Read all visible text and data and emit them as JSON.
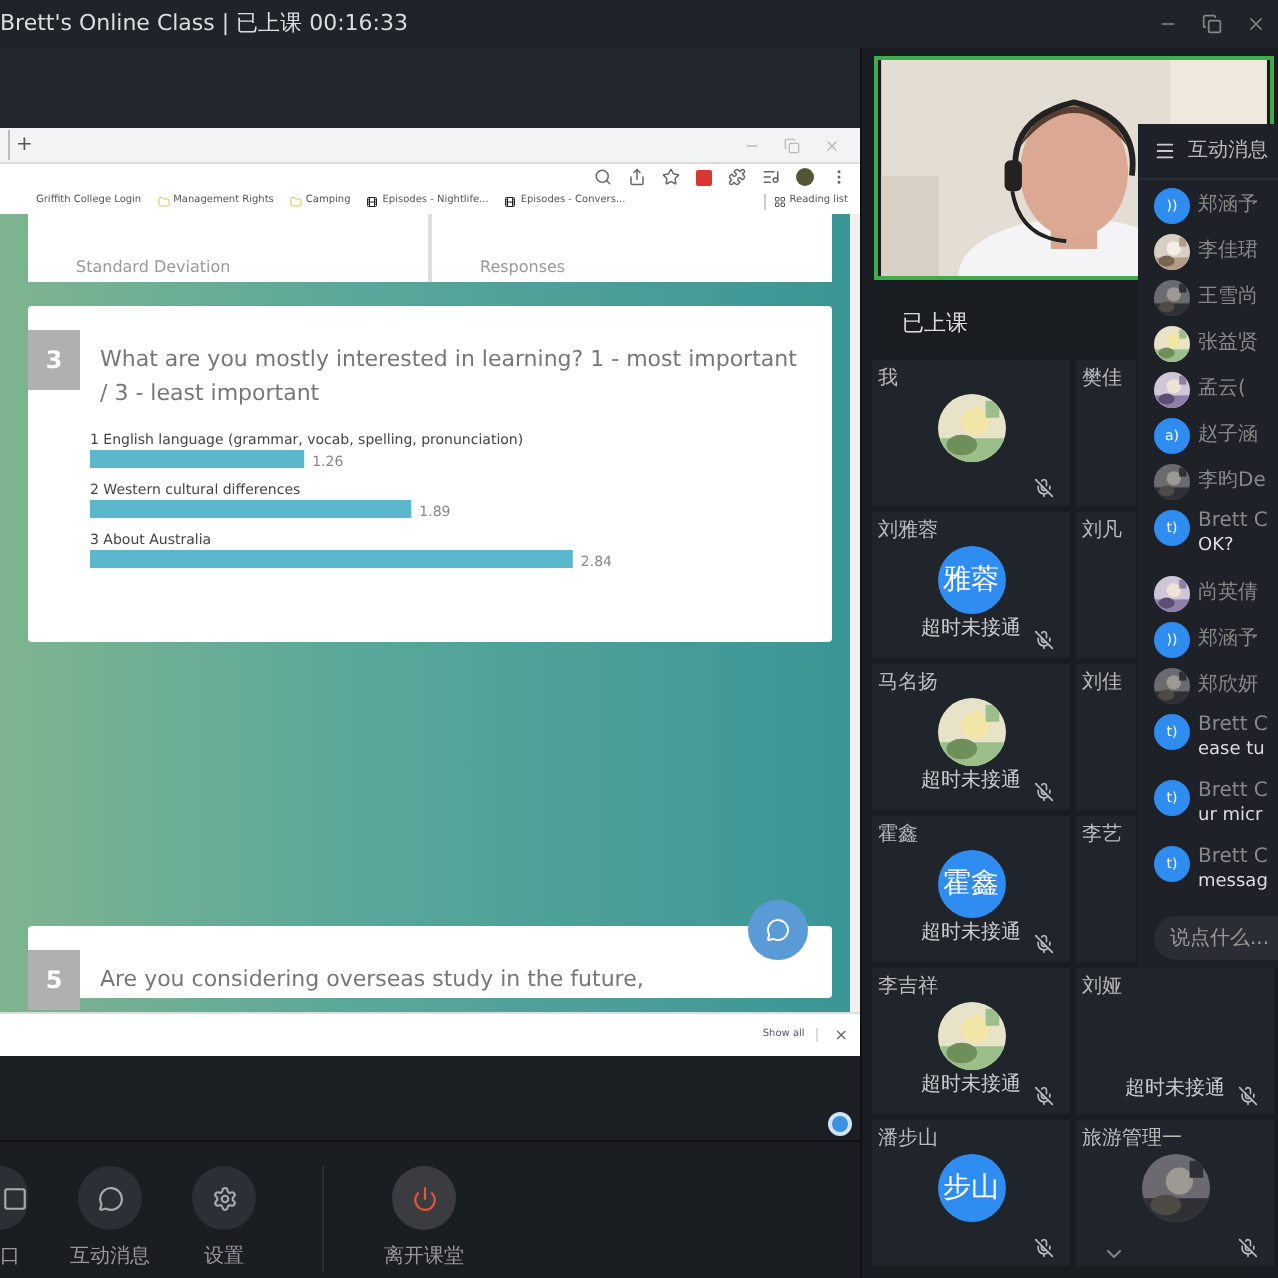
{
  "window": {
    "title": "Brett's Online Class | 已上课 00:16:33"
  },
  "browser": {
    "new_tab": "+",
    "bookmarks": [
      "Griffith College Login",
      "Management Rights",
      "Camping",
      "Episodes - Nightlife...",
      "Episodes - Convers..."
    ],
    "reading_list": "Reading list",
    "cards": [
      {
        "kind": "summary",
        "stats": [
          "Standard Deviation",
          "Responses"
        ]
      },
      {
        "kind": "question",
        "number": "3",
        "question": "What are you mostly interested in learning? 1 - most important / 3 - least important",
        "chart_data": {
          "type": "bar",
          "orientation": "horizontal",
          "categories": [
            "1 English language (grammar, vocab, spelling, pronunciation)",
            "2 Western cultural differences",
            "3 About Australia"
          ],
          "values": [
            1.26,
            1.89,
            2.84
          ],
          "data_labels": true
        }
      },
      {
        "kind": "question",
        "number": "5",
        "question": "Are you considering overseas study in the future,"
      }
    ],
    "download_bar": {
      "show_all": "Show all",
      "close": "×"
    }
  },
  "toolbar": [
    {
      "kind": "window",
      "label": "口"
    },
    {
      "kind": "chat",
      "label": "互动消息"
    },
    {
      "kind": "settings",
      "label": "设置"
    },
    {
      "kind": "leave",
      "label": "离开课堂"
    }
  ],
  "class_panel": {
    "status": "已上课",
    "participants": [
      {
        "name": "我",
        "muted": true
      },
      {
        "name": "樊佳"
      },
      {
        "name": "刘雅蓉",
        "avatar": {
          "kind": "initials",
          "text": "雅蓉"
        },
        "note": "超时未接通",
        "muted": true
      },
      {
        "name": "刘凡"
      },
      {
        "name": "马名扬",
        "note": "超时未接通",
        "muted": true
      },
      {
        "name": "刘佳"
      },
      {
        "name": "霍鑫",
        "avatar": {
          "kind": "initials",
          "text": "霍鑫"
        },
        "note": "超时未接通",
        "muted": true
      },
      {
        "name": "李艺"
      },
      {
        "name": "李吉祥",
        "note": "超时未接通",
        "muted": true
      },
      {
        "name": "刘娅",
        "note": "超时未接通",
        "muted": true
      },
      {
        "name": "潘步山",
        "avatar": {
          "kind": "initials",
          "text": "步山"
        },
        "muted": true
      },
      {
        "name": "旅游管理一",
        "muted": true
      }
    ]
  },
  "chat": {
    "title": "互动消息",
    "placeholder": "说点什么...",
    "messages": [
      {
        "name": "郑涵予",
        "avatar": {
          "kind": "initials",
          "text": "))"
        }
      },
      {
        "name": "李佳珺"
      },
      {
        "name": "王雪尚"
      },
      {
        "name": "张益贤"
      },
      {
        "name": "孟云("
      },
      {
        "name": "赵子涵",
        "avatar": {
          "kind": "initials",
          "text": "a)"
        }
      },
      {
        "name": "李昀De"
      },
      {
        "name": "Brett C",
        "text": "OK?",
        "avatar": {
          "kind": "initials",
          "text": "t)"
        }
      },
      {
        "name": "尚英倩"
      },
      {
        "name": "郑涵予",
        "avatar": {
          "kind": "initials",
          "text": "))"
        }
      },
      {
        "name": "郑欣妍"
      },
      {
        "name": "Brett C",
        "text": "ease tu",
        "avatar": {
          "kind": "initials",
          "text": "t)"
        }
      },
      {
        "name": "Brett C",
        "text": "ur micr",
        "avatar": {
          "kind": "initials",
          "text": "t)"
        }
      },
      {
        "name": "Brett C",
        "text": "messag",
        "avatar": {
          "kind": "initials",
          "text": "t)"
        }
      }
    ]
  }
}
